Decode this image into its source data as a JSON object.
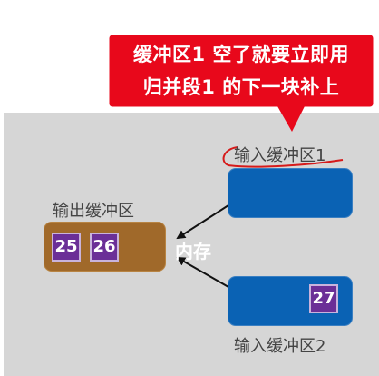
{
  "callout": {
    "line1": "缓冲区1 空了就要立即用",
    "line2": "归并段1 的下一块补上",
    "fill_color": "#e8081b"
  },
  "labels": {
    "input_buffer_1": "输入缓冲区1",
    "input_buffer_2": "输入缓冲区2",
    "output_buffer": "输出缓冲区",
    "memory": "内存"
  },
  "blocks": {
    "output": [
      "25",
      "26"
    ],
    "input2": "27"
  },
  "colors": {
    "panel": "#d6d6d6",
    "input_buffer": "#0a62b4",
    "output_buffer": "#a0692a",
    "block": "#6b2f97",
    "annotation": "#d61a1a"
  }
}
